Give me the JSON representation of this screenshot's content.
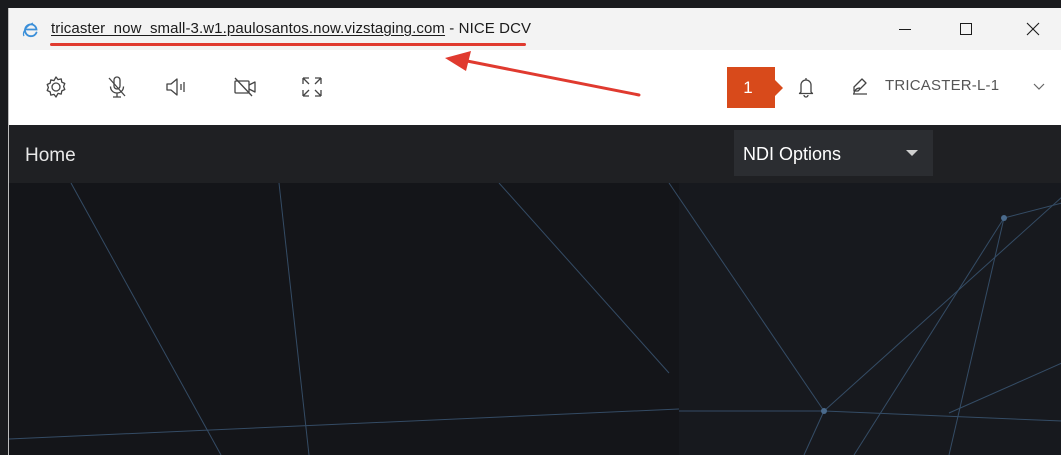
{
  "window": {
    "title_host": "tricaster_now_small-3.w1.paulosantos.now.vizstaging.com",
    "title_separator": " - ",
    "title_app": "NICE DCV",
    "accent_underline_color": "#e03a2f"
  },
  "window_controls": {
    "minimize_icon": "minimize-icon",
    "maximize_icon": "maximize-icon",
    "close_icon": "close-icon"
  },
  "toolbar": {
    "icons": [
      "gear-icon",
      "microphone-muted-icon",
      "speaker-icon",
      "camera-off-icon",
      "fullscreen-icon"
    ],
    "notification_count": "1",
    "notification_color": "#d84a1b",
    "bell_icon": "bell-icon",
    "user_icon": "user-edit-icon",
    "user_name": "TRICASTER-L-1",
    "user_menu_icon": "chevron-down-icon"
  },
  "content": {
    "page_title": "Home",
    "ndi_select": {
      "selected": "NDI Options"
    }
  },
  "annotation": {
    "arrow_color": "#e03a2f"
  }
}
